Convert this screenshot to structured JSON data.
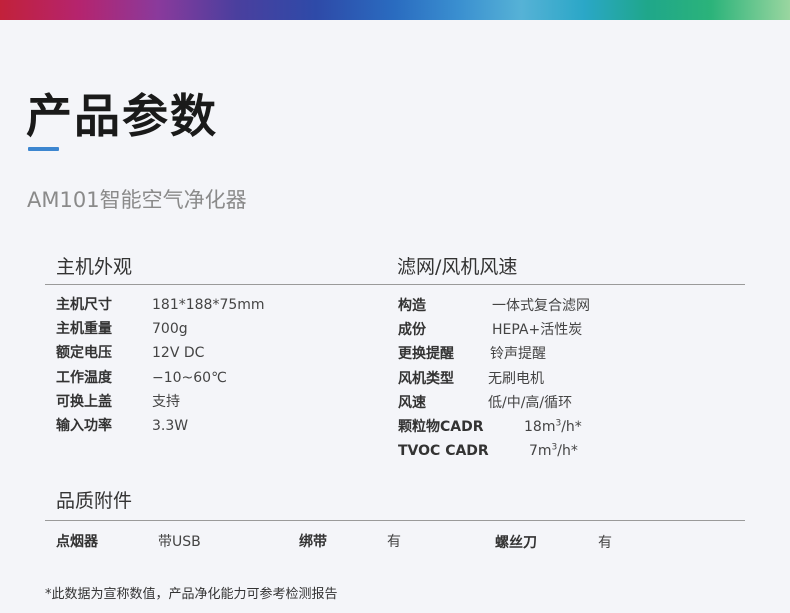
{
  "banner": {
    "colors": [
      "#c2213a",
      "#8a3a9c",
      "#2a6cc0",
      "#56b2d6",
      "#1fa78a",
      "#9ad6a0"
    ]
  },
  "title": "产品参数",
  "accent_color": "#3c86d0",
  "subtitle": "AM101智能空气净化器",
  "host": {
    "heading": "主机外观",
    "rows": [
      {
        "label": "主机尺寸",
        "value": "181*188*75mm"
      },
      {
        "label": "主机重量",
        "value": "700g"
      },
      {
        "label": "额定电压",
        "value": "12V DC"
      },
      {
        "label": "工作温度",
        "value": "−10~60℃"
      },
      {
        "label": "可换上盖",
        "value": "支持"
      },
      {
        "label": "输入功率",
        "value": "3.3W"
      }
    ]
  },
  "filter": {
    "heading": "滤网/风机风速",
    "rows": [
      {
        "label": "构造",
        "value": "一体式复合滤网"
      },
      {
        "label": "成份",
        "value": "HEPA+活性炭"
      },
      {
        "label": "更换提醒",
        "value": "铃声提醒"
      },
      {
        "label": "风机类型",
        "value": "无刷电机"
      },
      {
        "label": "风速",
        "value": "低/中/高/循环"
      },
      {
        "label": "颗粒物CADR",
        "value_prefix": "18m",
        "value_sup": "3",
        "value_suffix": "/h*"
      },
      {
        "label": "TVOC CADR",
        "value_prefix": "7m",
        "value_sup": "3",
        "value_suffix": "/h*"
      }
    ]
  },
  "accessories": {
    "heading": "品质附件",
    "items": [
      {
        "label": "点烟器",
        "value": "带USB"
      },
      {
        "label": "绑带",
        "value": "有"
      },
      {
        "label": "螺丝刀",
        "value": "有"
      }
    ]
  },
  "footnote": "*此数据为宣称数值，产品净化能力可参考检测报告"
}
